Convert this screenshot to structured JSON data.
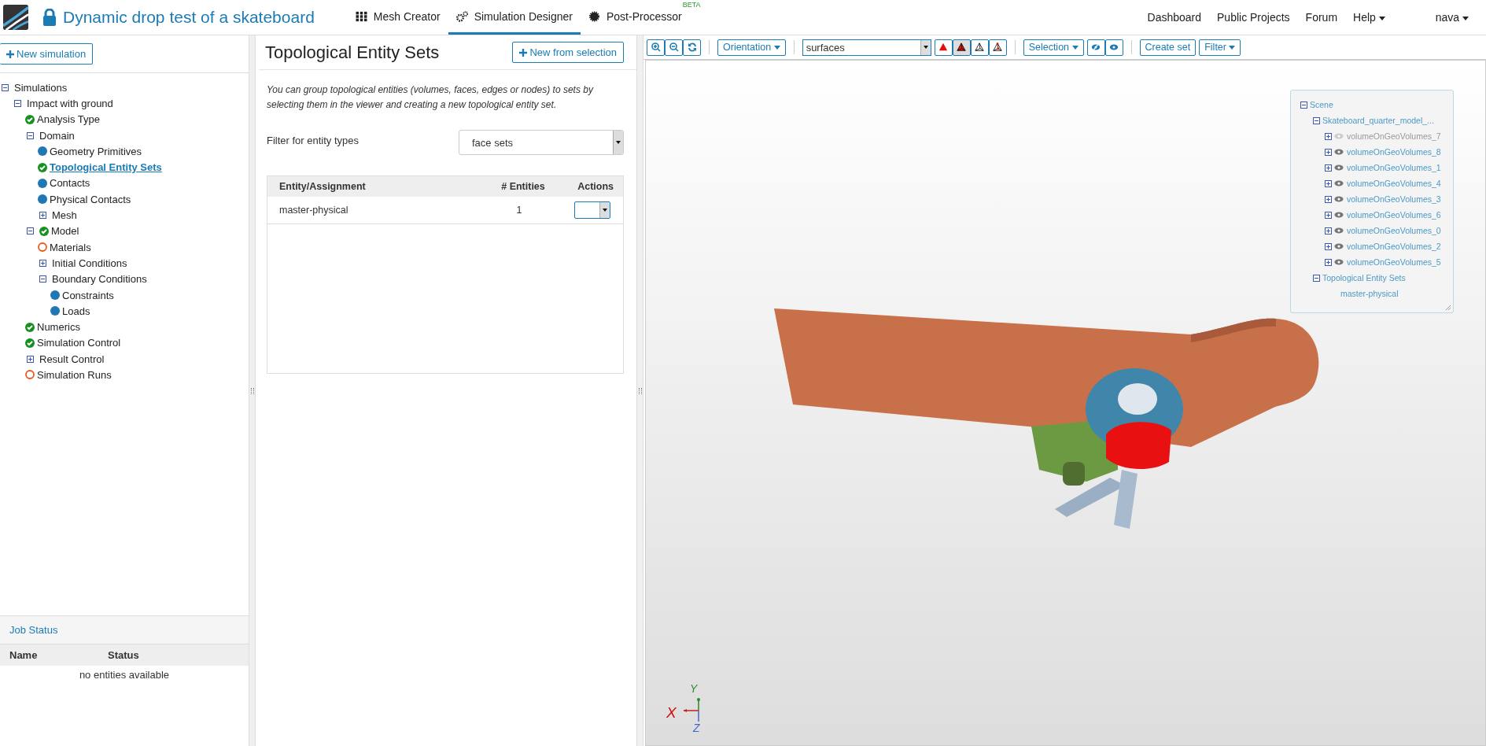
{
  "header": {
    "title": "Dynamic drop test of a skateboard",
    "modules": [
      {
        "label": "Mesh Creator",
        "kind": "grid",
        "selected": false
      },
      {
        "label": "Simulation Designer",
        "kind": "gears",
        "selected": true
      },
      {
        "label": "Post-Processor",
        "kind": "cog",
        "selected": false,
        "badge": "BETA"
      }
    ],
    "links": [
      "Dashboard",
      "Public Projects",
      "Forum"
    ],
    "menus": [
      "Help",
      "nava"
    ]
  },
  "sidebar": {
    "new_button": "New simulation",
    "tree": [
      {
        "label": "Simulations",
        "expanded": true,
        "selected": false,
        "children": [
          {
            "label": "Impact with ground",
            "expanded": true,
            "selected": false,
            "children": [
              {
                "label": "Analysis Type",
                "kind": "done",
                "selected": false
              },
              {
                "label": "Domain",
                "expanded": true,
                "selected": false,
                "children": [
                  {
                    "label": "Geometry Primitives",
                    "kind": "info",
                    "selected": false
                  },
                  {
                    "label": "Topological Entity Sets",
                    "kind": "done",
                    "selected": true
                  },
                  {
                    "label": "Contacts",
                    "kind": "info",
                    "selected": false
                  },
                  {
                    "label": "Physical Contacts",
                    "kind": "info",
                    "selected": false
                  },
                  {
                    "label": "Mesh",
                    "expanded": false,
                    "selected": false
                  }
                ]
              },
              {
                "label": "Model",
                "kind": "done",
                "expanded": true,
                "selected": false,
                "children": [
                  {
                    "label": "Materials",
                    "kind": "todo",
                    "selected": false
                  },
                  {
                    "label": "Initial Conditions",
                    "expanded": false,
                    "selected": false
                  },
                  {
                    "label": "Boundary Conditions",
                    "expanded": true,
                    "selected": false,
                    "children": [
                      {
                        "label": "Constraints",
                        "kind": "info",
                        "selected": false
                      },
                      {
                        "label": "Loads",
                        "kind": "info",
                        "selected": false
                      }
                    ]
                  }
                ]
              },
              {
                "label": "Numerics",
                "kind": "done",
                "selected": false
              },
              {
                "label": "Simulation Control",
                "kind": "done",
                "selected": false
              },
              {
                "label": "Result Control",
                "expanded": false,
                "selected": false
              },
              {
                "label": "Simulation Runs",
                "kind": "todo",
                "selected": false
              }
            ]
          }
        ]
      }
    ],
    "job_status": {
      "title": "Job Status",
      "columns": [
        "Name",
        "Status"
      ],
      "empty": "no entities available"
    }
  },
  "panel": {
    "title": "Topological Entity Sets",
    "new_button": "New from selection",
    "description": "You can group topological entities (volumes, faces, edges or nodes) to sets by selecting them in the viewer and creating a new topological entity set.",
    "filter_label": "Filter for entity types",
    "filter_value": "face sets",
    "table": {
      "columns": [
        "Entity/Assignment",
        "# Entities",
        "Actions"
      ],
      "rows": [
        {
          "name": "master-physical",
          "count": "1"
        }
      ]
    }
  },
  "viewer": {
    "toolbar": {
      "orientation": "Orientation",
      "display": "surfaces",
      "render_modes": [
        {
          "kind": "solid",
          "selected": false
        },
        {
          "kind": "solid-edges",
          "selected": true
        },
        {
          "kind": "wireframe",
          "selected": false
        },
        {
          "kind": "points",
          "selected": false
        }
      ],
      "selection": "Selection",
      "create_set": "Create set",
      "filter": "Filter"
    },
    "scene": {
      "label": "Scene",
      "children": [
        {
          "label": "Skateboard_quarter_model_...",
          "volumes": [
            {
              "label": "volumeOnGeoVolumes_7",
              "visible": false
            },
            {
              "label": "volumeOnGeoVolumes_8",
              "visible": true
            },
            {
              "label": "volumeOnGeoVolumes_1",
              "visible": true
            },
            {
              "label": "volumeOnGeoVolumes_4",
              "visible": true
            },
            {
              "label": "volumeOnGeoVolumes_3",
              "visible": true
            },
            {
              "label": "volumeOnGeoVolumes_6",
              "visible": true
            },
            {
              "label": "volumeOnGeoVolumes_0",
              "visible": true
            },
            {
              "label": "volumeOnGeoVolumes_2",
              "visible": true
            },
            {
              "label": "volumeOnGeoVolumes_5",
              "visible": true
            }
          ]
        }
      ],
      "sets_label": "Topological Entity Sets",
      "sets": [
        "master-physical"
      ]
    },
    "axes": {
      "x": "X",
      "y": "Y",
      "z": "Z"
    }
  }
}
